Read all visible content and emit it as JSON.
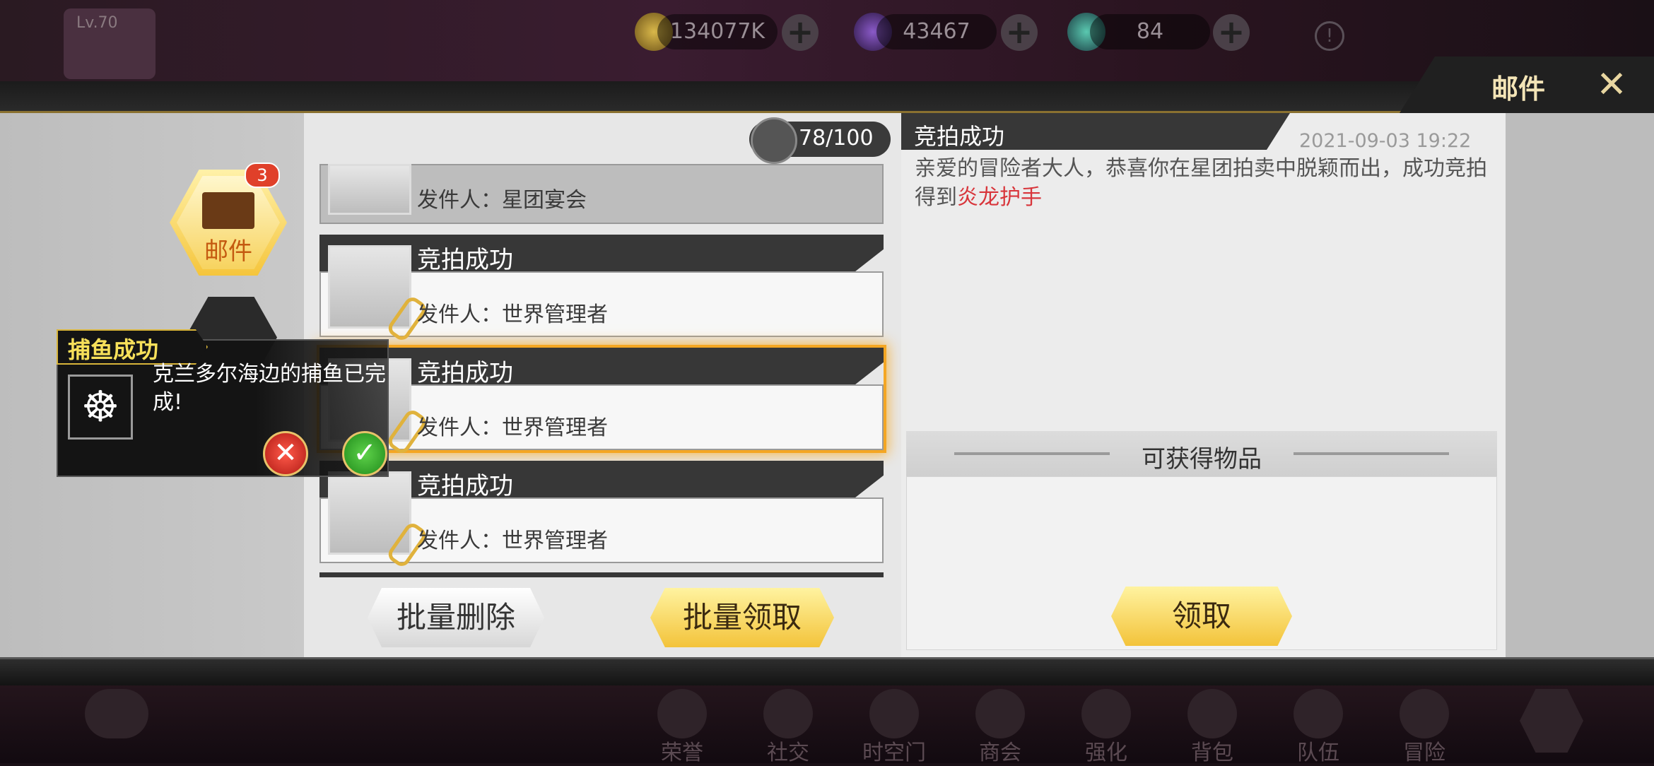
{
  "hud": {
    "level": "Lv.70",
    "gold": "134077K",
    "crystal": "43467",
    "tickets": "84"
  },
  "window": {
    "title": "邮件",
    "close": "✕"
  },
  "sidebar": {
    "mail_tab": "邮件",
    "mail_badge": "3"
  },
  "mailbox": {
    "count": "78/100",
    "mails": [
      {
        "subject": "",
        "sender": "发件人：星团宴会"
      },
      {
        "subject": "竞拍成功",
        "sender": "发件人：世界管理者"
      },
      {
        "subject": "竞拍成功",
        "sender": "发件人：世界管理者"
      },
      {
        "subject": "竞拍成功",
        "sender": "发件人：世界管理者"
      }
    ],
    "batch_delete": "批量删除",
    "batch_collect": "批量领取"
  },
  "detail": {
    "title": "竞拍成功",
    "date": "2021-09-03  19:22",
    "body": "亲爱的冒险者大人，恭喜你在星团拍卖中脱颖而出，成功竞拍得到",
    "item": "炎龙护手",
    "items_header": "可获得物品",
    "claim": "领取"
  },
  "popup": {
    "title": "捕鱼成功",
    "message": "克兰多尔海边的捕鱼已完成!",
    "no": "✕",
    "yes": "✓"
  },
  "bottom_nav": [
    "荣誉",
    "社交",
    "时空门",
    "商会",
    "强化",
    "背包",
    "队伍",
    "冒险"
  ],
  "colors": {
    "accent_gold": "#f3c33a",
    "highlight_red": "#d8353b",
    "dark_header": "#373737"
  }
}
